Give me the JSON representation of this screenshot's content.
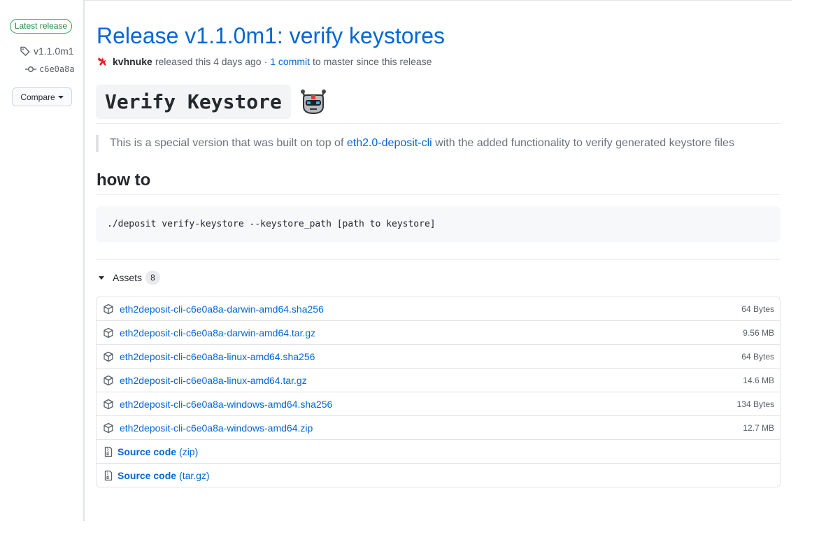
{
  "sidebar": {
    "badge": "Latest release",
    "tag": "v1.1.0m1",
    "commit": "c6e0a8a",
    "compare_label": "Compare"
  },
  "release": {
    "title": "Release v1.1.0m1: verify keystores",
    "author": "kvhnuke",
    "released_text": "released this 4 days ago",
    "separator": "·",
    "commits_link": "1 commit",
    "commits_suffix": "to master since this release"
  },
  "body": {
    "heading": "Verify Keystore",
    "heading_emoji": "robot-icon",
    "quote_prefix": "This is a special version that was built on top of",
    "quote_link": "eth2.0-deposit-cli",
    "quote_suffix": "with the added functionality to verify generated keystore files",
    "howto_heading": "how to",
    "code": "./deposit verify-keystore --keystore_path [path to keystore]"
  },
  "assets": {
    "label": "Assets",
    "count": "8",
    "files": [
      {
        "name": "eth2deposit-cli-c6e0a8a-darwin-amd64.sha256",
        "size": "64 Bytes"
      },
      {
        "name": "eth2deposit-cli-c6e0a8a-darwin-amd64.tar.gz",
        "size": "9.56 MB"
      },
      {
        "name": "eth2deposit-cli-c6e0a8a-linux-amd64.sha256",
        "size": "64 Bytes"
      },
      {
        "name": "eth2deposit-cli-c6e0a8a-linux-amd64.tar.gz",
        "size": "14.6 MB"
      },
      {
        "name": "eth2deposit-cli-c6e0a8a-windows-amd64.sha256",
        "size": "134 Bytes"
      },
      {
        "name": "eth2deposit-cli-c6e0a8a-windows-amd64.zip",
        "size": "12.7 MB"
      }
    ],
    "source": [
      {
        "label": "Source code",
        "format": "(zip)"
      },
      {
        "label": "Source code",
        "format": "(tar.gz)"
      }
    ]
  },
  "colors": {
    "link": "#0366d6",
    "badge_green": "#28a745",
    "muted": "#586069"
  }
}
